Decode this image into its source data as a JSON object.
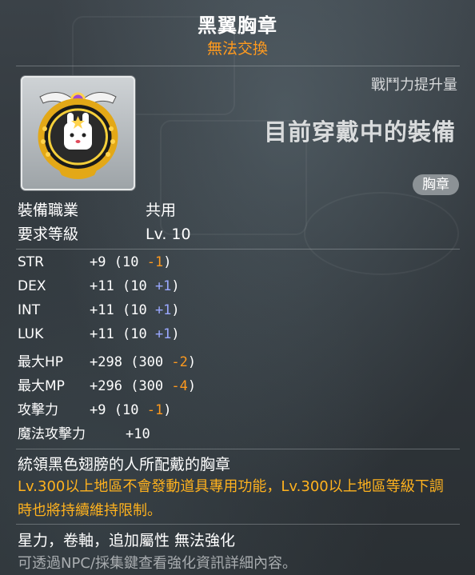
{
  "item": {
    "name": "黑翼胸章",
    "trade_status": "無法交換",
    "power_label": "戰鬥力提升量",
    "equipped_text": "目前穿戴中的裝備",
    "slot": "胸章",
    "icon": "black-wing-medal-icon"
  },
  "requirements": [
    {
      "label": "裝備職業",
      "value": "共用"
    },
    {
      "label": "要求等級",
      "value": "Lv. 10"
    }
  ],
  "stats": [
    {
      "name": "STR",
      "value": "+9",
      "base": "(10",
      "diff": "-1",
      "close": ")",
      "diff_color": "orange"
    },
    {
      "name": "DEX",
      "value": "+11",
      "base": "(10",
      "diff": "+1",
      "close": ")",
      "diff_color": "blue"
    },
    {
      "name": "INT",
      "value": "+11",
      "base": "(10",
      "diff": "+1",
      "close": ")",
      "diff_color": "blue"
    },
    {
      "name": "LUK",
      "value": "+11",
      "base": "(10",
      "diff": "+1",
      "close": ")",
      "diff_color": "blue"
    },
    {
      "name": "最大HP",
      "value": "+298",
      "base": "(300",
      "diff": "-2",
      "close": ")",
      "diff_color": "orange"
    },
    {
      "name": "最大MP",
      "value": "+296",
      "base": "(300",
      "diff": "-4",
      "close": ")",
      "diff_color": "orange"
    },
    {
      "name": "攻擊力",
      "value": "+9",
      "base": "(10",
      "diff": "-1",
      "close": ")",
      "diff_color": "orange"
    },
    {
      "name": "魔法攻擊力",
      "value": "+10",
      "base": "",
      "diff": "",
      "close": "",
      "diff_color": "none"
    }
  ],
  "description": "統領黑色翅膀的人所配戴的胸章",
  "notice": "Lv.300以上地區不會發動道具專用功能，Lv.300以上地區等級下調時也將持續維持限制。",
  "enhance_note": "星力，卷軸，追加屬性 無法強化",
  "hint": "可透過NPC/採集鍵查看強化資訊詳細內容。",
  "colors": {
    "orange": "#ff9a1e",
    "blue": "#9aa8ff",
    "notice": "#ffb21e"
  }
}
